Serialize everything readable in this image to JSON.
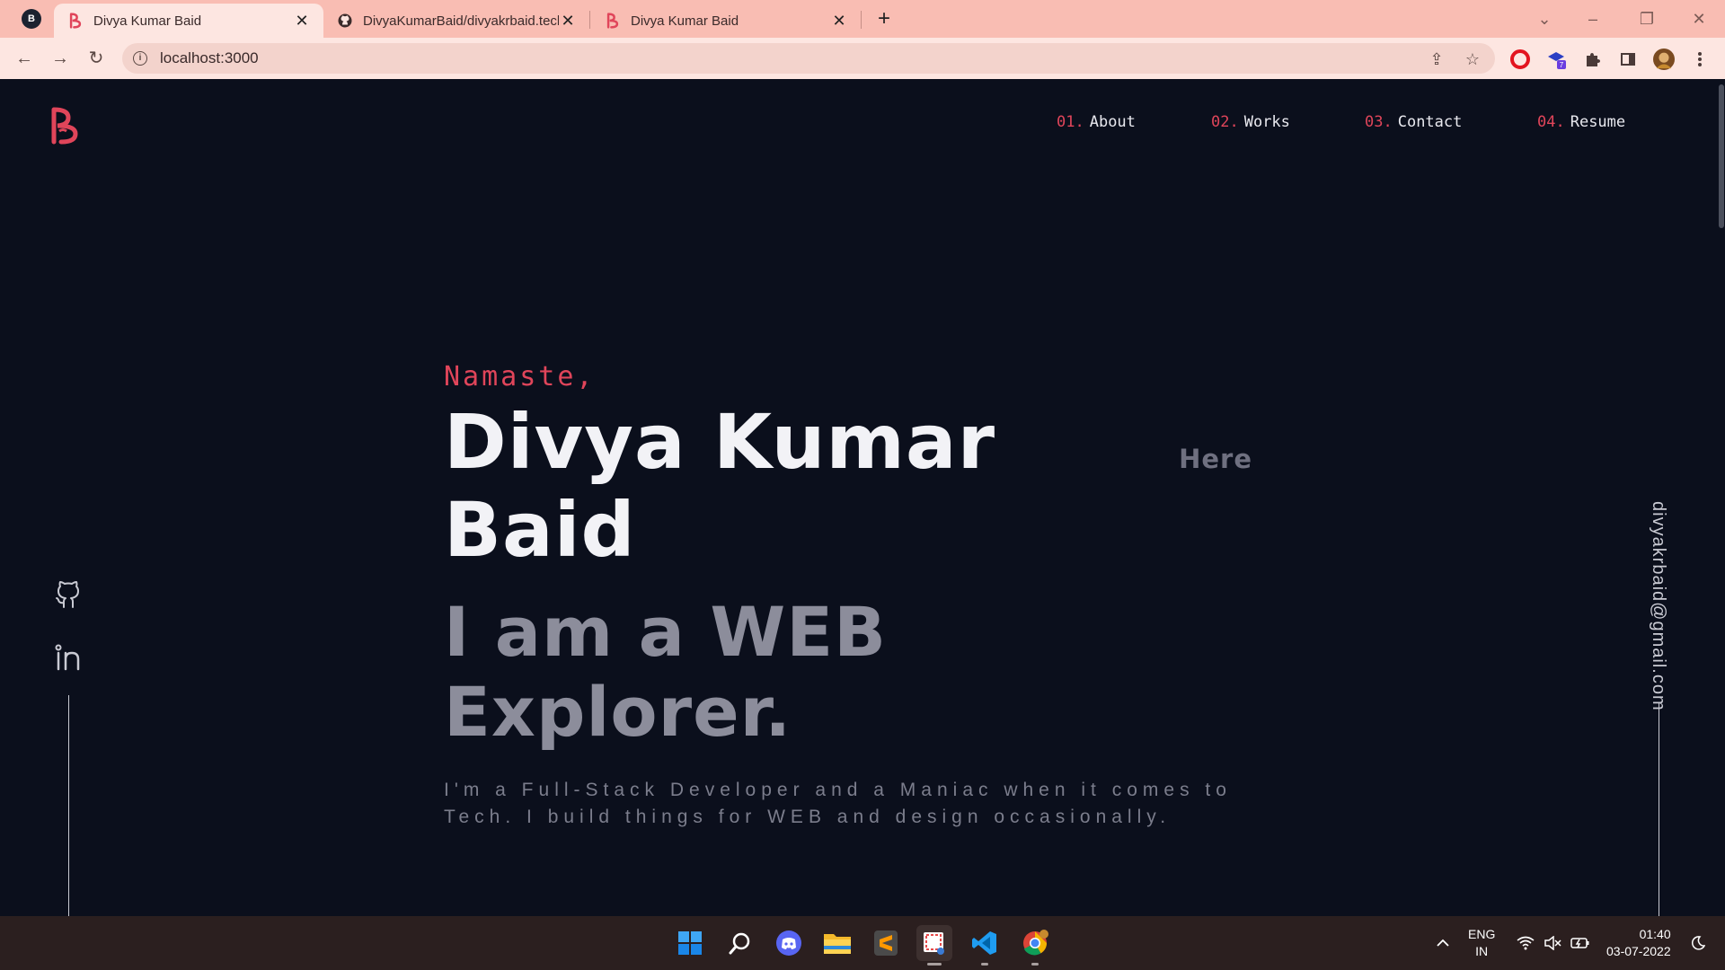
{
  "browser": {
    "tabs": [
      {
        "title": "Divya Kumar Baid",
        "active": true
      },
      {
        "title": "DivyaKumarBaid/divyakrbaid.tech",
        "active": false
      },
      {
        "title": "Divya Kumar Baid",
        "active": false
      }
    ],
    "profile_chip": "B",
    "url": "localhost:3000",
    "extension_badge": "7",
    "colors": {
      "tabbar": "#f9bdb3",
      "toolbar": "#fde6e1",
      "accent": "#e0455a"
    }
  },
  "site": {
    "nav": [
      {
        "num": "01.",
        "label": "About"
      },
      {
        "num": "02.",
        "label": "Works"
      },
      {
        "num": "03.",
        "label": "Contact"
      },
      {
        "num": "04.",
        "label": "Resume"
      }
    ],
    "hero": {
      "greeting": "Namaste,",
      "name": "Divya Kumar Baid",
      "name_suffix": "Here",
      "tagline": "I am a WEB Explorer.",
      "description": "I'm a Full-Stack Developer and a Maniac when it comes to Tech. I build things for WEB and design occasionally."
    },
    "social": [
      "github-icon",
      "linkedin-icon"
    ],
    "email": "divyakrbaid@gmail.com",
    "colors": {
      "background": "#0b0f1c",
      "accent": "#e0455a",
      "text": "#f2f2f6",
      "muted": "#8c8d9b"
    }
  },
  "taskbar": {
    "apps": [
      "start-icon",
      "search-icon",
      "discord-icon",
      "file-explorer-icon",
      "sublime-text-icon",
      "snipping-tool-icon",
      "vscode-icon",
      "chrome-icon"
    ],
    "language": "ENG",
    "region": "IN",
    "time": "01:40",
    "date": "03-07-2022"
  }
}
